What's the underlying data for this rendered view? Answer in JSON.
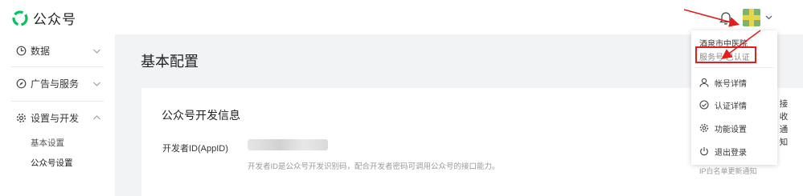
{
  "app": {
    "name": "公众号",
    "logo_icon": "wechat-official-account-logo-icon"
  },
  "header": {
    "notification_icon": "bell-icon",
    "dropdown_icon": "chevron-down-icon"
  },
  "sidebar": {
    "items": [
      {
        "label": "数据",
        "icon": "chart-icon",
        "expanded": false
      },
      {
        "label": "广告与服务",
        "icon": "compass-icon",
        "expanded": false
      },
      {
        "label": "设置与开发",
        "icon": "gear-icon",
        "expanded": true
      }
    ],
    "subitems": [
      {
        "label": "基本设置",
        "active": false
      },
      {
        "label": "公众号设置",
        "active": true
      }
    ]
  },
  "main": {
    "page_title": "基本配置",
    "section_title": "公众号开发信息",
    "appid_label": "开发者ID(AppID)",
    "appid_hint": "开发者ID是公众号开发识别码，配合开发者密码可调用公众号的接口能力。"
  },
  "account_menu": {
    "account_name": "酒泉市中医院",
    "account_type": "服务号 已认证",
    "items": [
      {
        "label": "帐号详情",
        "icon": "user-icon"
      },
      {
        "label": "认证详情",
        "icon": "check-circle-icon"
      },
      {
        "label": "功能设置",
        "icon": "gear-icon"
      },
      {
        "label": "退出登录",
        "icon": "power-icon"
      }
    ],
    "more_text": "IP白名单更新通知"
  },
  "side_note": "接收通知",
  "annotation": {
    "highlight_color": "#e02020"
  }
}
